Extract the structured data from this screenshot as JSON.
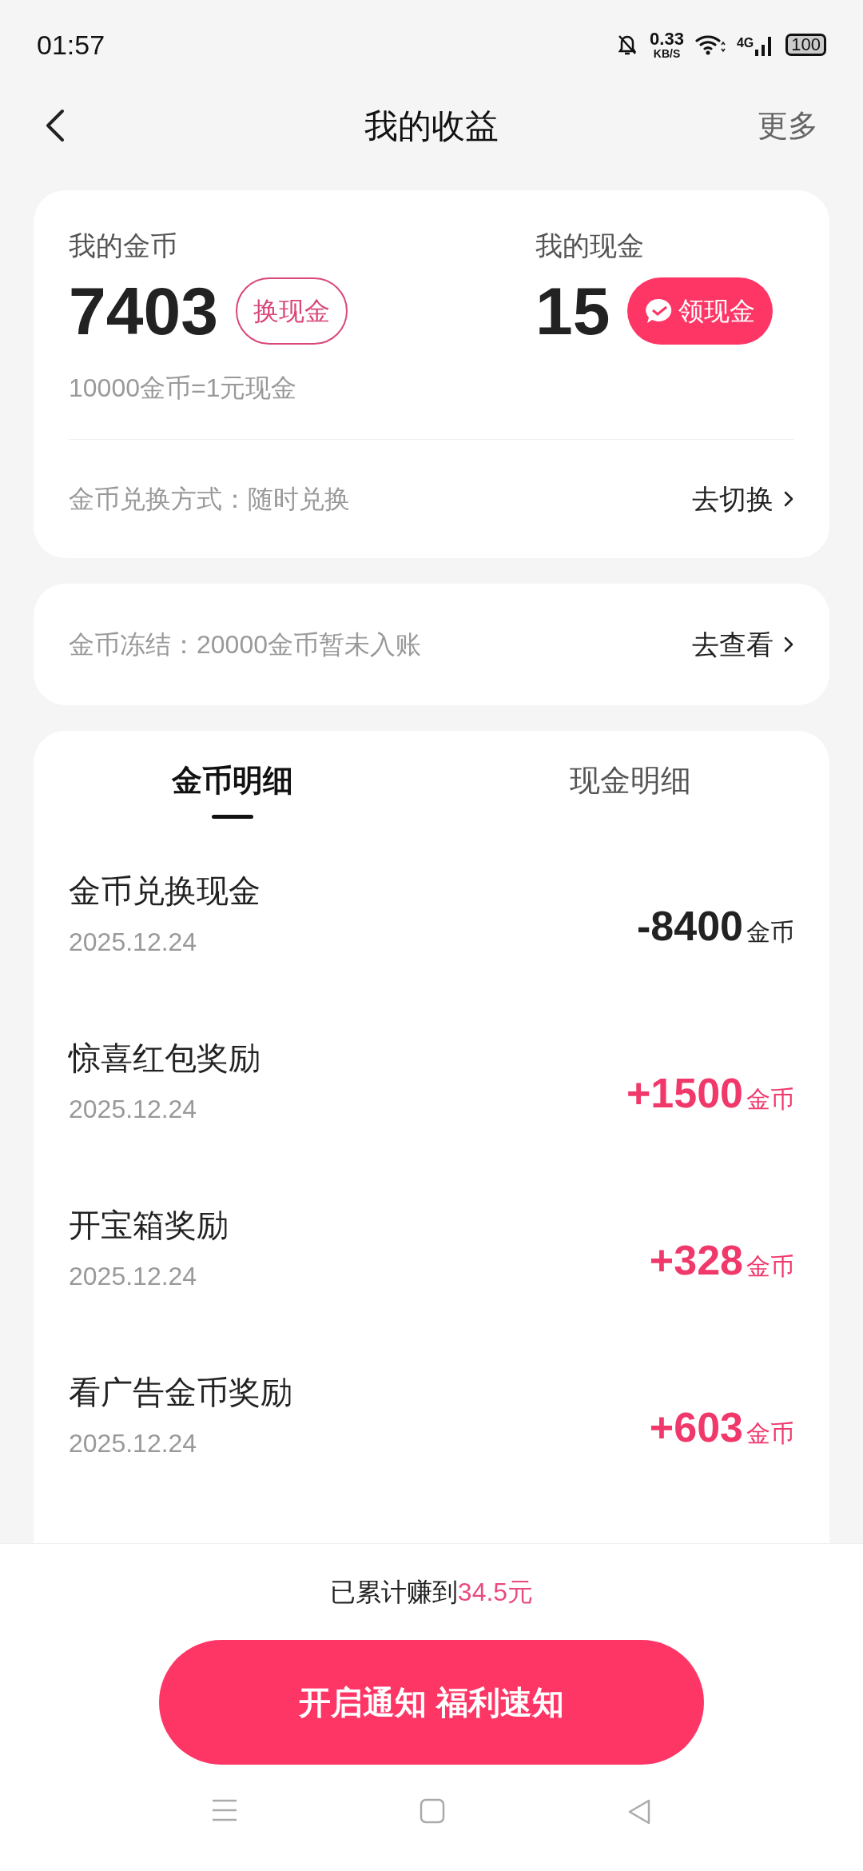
{
  "status_bar": {
    "time": "01:57",
    "net_speed": "0.33",
    "net_unit": "KB/S",
    "network": "4G",
    "battery": "100"
  },
  "header": {
    "title": "我的收益",
    "more": "更多"
  },
  "balances": [
    {
      "label": "我的金币",
      "value": "7403",
      "action": {
        "label": "换现金",
        "kind": "outline"
      }
    },
    {
      "label": "我的现金",
      "value": "15",
      "action": {
        "label": "领现金",
        "kind": "filled"
      }
    }
  ],
  "rate": "10000金币=1元现金",
  "exchange_mode": {
    "label": "金币兑换方式：随时兑换",
    "link": "去切换"
  },
  "frozen": {
    "label": "金币冻结：20000金币暂未入账",
    "link": "去查看"
  },
  "tabs": [
    {
      "label": "金币明细",
      "selected": true
    },
    {
      "label": "现金明细",
      "selected": false
    }
  ],
  "records": [
    {
      "title": "金币兑换现金",
      "date": "2025.12.24",
      "amount": "-8400",
      "unit": "金币",
      "kind": "debit"
    },
    {
      "title": "惊喜红包奖励",
      "date": "2025.12.24",
      "amount": "+1500",
      "unit": "金币",
      "kind": "credit"
    },
    {
      "title": "开宝箱奖励",
      "date": "2025.12.24",
      "amount": "+328",
      "unit": "金币",
      "kind": "credit"
    },
    {
      "title": "看广告金币奖励",
      "date": "2025.12.24",
      "amount": "+603",
      "unit": "金币",
      "kind": "credit"
    }
  ],
  "earned": {
    "prefix": "已累计赚到",
    "amount": "34.5元"
  },
  "cta": "开启通知 福利速知"
}
